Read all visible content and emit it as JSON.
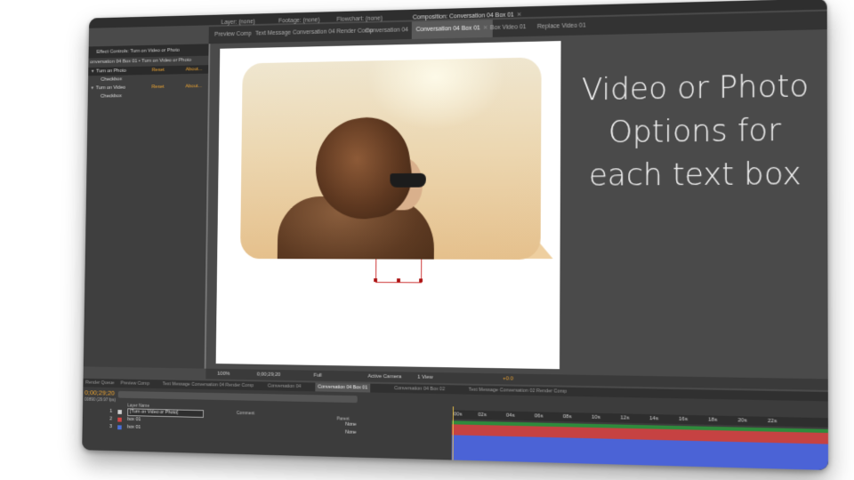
{
  "top_tabs": [
    {
      "label": "Layer: (none)",
      "active": false
    },
    {
      "label": "Footage: (none)",
      "active": false
    },
    {
      "label": "Flowchart: (none)",
      "active": false
    },
    {
      "label": "Composition: Conversation 04 Box 01",
      "active": false
    },
    {
      "label": "Preview Comp",
      "active": false
    },
    {
      "label": "Text Message Conversation 04 Render Comp",
      "active": false
    },
    {
      "label": "Conversation 04",
      "active": false
    },
    {
      "label": "Conversation 04 Box 01",
      "active": true
    },
    {
      "label": "Box Video 01",
      "active": false
    },
    {
      "label": "Replace Video 01",
      "active": false
    }
  ],
  "effect_controls": {
    "title": "Effect Controls: Turn on Video or Photo",
    "subtitle": "onversation 04 Box 01 • Turn on Video or Photo",
    "rows": [
      {
        "name": "Turn on Photo",
        "reset": "Reset",
        "about": "About..."
      },
      {
        "child": "Checkbox"
      },
      {
        "name": "Turn on Video",
        "reset": "Reset",
        "about": "About..."
      },
      {
        "child": "Checkbox"
      }
    ]
  },
  "caption_lines": [
    "Video or Photo",
    "Options for",
    "each text box"
  ],
  "viewer_bar": {
    "zoom": "100%",
    "timecode": "0;00;29;20",
    "resolution": "Full",
    "camera": "Active Camera",
    "view": "1 View",
    "exposure": "+0.0"
  },
  "timeline_tabs": [
    {
      "label": "Render Queue",
      "active": false
    },
    {
      "label": "Preview Comp",
      "active": false
    },
    {
      "label": "Text Message Conversation 04 Render Comp",
      "active": false
    },
    {
      "label": "Conversation 04",
      "active": false
    },
    {
      "label": "Conversation 04 Box 01",
      "active": true
    },
    {
      "label": "Conversation 04 Box 02",
      "active": false
    },
    {
      "label": "Text Message Conversation 02 Render Comp",
      "active": false
    }
  ],
  "timeline": {
    "timecode": "0;00;29;20",
    "fps": "00890 (29.97 fps)",
    "col_layer_name": "Layer Name",
    "col_comment": "Comment",
    "col_parent": "Parent",
    "layers": [
      {
        "num": "1",
        "name": "[Turn on Video or Photo]",
        "parent": "",
        "color": "#cfcfcf"
      },
      {
        "num": "2",
        "name": "box 01",
        "parent": "None",
        "color": "#d24545"
      },
      {
        "num": "3",
        "name": "box 01",
        "parent": "None",
        "color": "#4a6fd8"
      }
    ],
    "ruler_ticks": [
      "00s",
      "02s",
      "04s",
      "06s",
      "08s",
      "10s",
      "12s",
      "14s",
      "16s",
      "18s",
      "20s",
      "22s"
    ]
  },
  "colors": {
    "accent_orange": "#e9a232",
    "layer_red": "#c64242",
    "layer_blue": "#4b63d6",
    "layer_green": "#2f8a3c"
  }
}
